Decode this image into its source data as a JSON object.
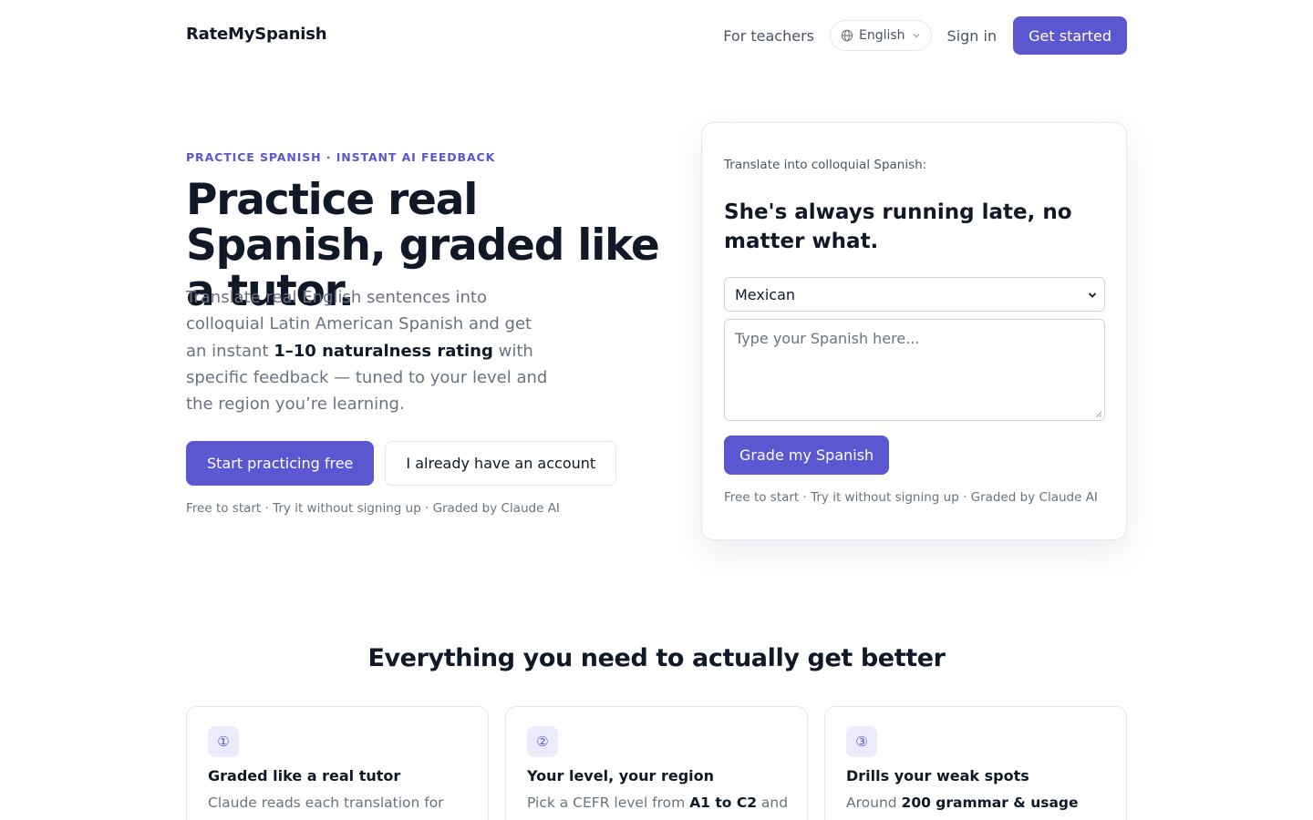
{
  "header": {
    "brand": "RateMySpanish",
    "for_teachers": "For teachers",
    "language": "English",
    "sign_in": "Sign in",
    "get_started": "Get started"
  },
  "hero": {
    "eyebrow": "PRACTICE SPANISH · INSTANT AI FEEDBACK",
    "title": "Practice real Spanish, graded like a tutor.",
    "subtitle_before": "Translate real English sentences into colloquial Latin American Spanish and get an instant ",
    "subtitle_bold": "1–10 naturalness rating",
    "subtitle_after": " with specific feedback — tuned to your level and the region you’re learning.",
    "cta_primary": "Start practicing free",
    "cta_secondary": "I already have an account",
    "note": "Free to start · Try it without signing up · Graded by Claude AI"
  },
  "demo": {
    "prompt": "Translate into colloquial Spanish:",
    "sentence": "She's always running late, no matter what.",
    "region_selected": "Mexican",
    "placeholder": "Type your Spanish here...",
    "grade_button": "Grade my Spanish",
    "note": "Free to start · Try it without signing up · Graded by Claude AI"
  },
  "features": {
    "title": "Everything you need to actually get better",
    "items": [
      {
        "badge": "①",
        "title": "Graded like a real tutor",
        "body_before": "Claude reads each translation for",
        "body_bold": "",
        "body_after": ""
      },
      {
        "badge": "②",
        "title": "Your level, your region",
        "body_before": "Pick a CEFR level from ",
        "body_bold": "A1 to C2",
        "body_after": " and a"
      },
      {
        "badge": "③",
        "title": "Drills your weak spots",
        "body_before": "Around ",
        "body_bold": "200 grammar & usage",
        "body_after": ""
      }
    ]
  },
  "colors": {
    "accent": "#5b57d1",
    "accent_soft": "#ecebfb",
    "text": "#111827",
    "muted": "#6b7280",
    "border": "#e5e7eb"
  },
  "icons": [
    "globe-icon",
    "chevron-down-icon",
    "resize-grip-icon"
  ]
}
